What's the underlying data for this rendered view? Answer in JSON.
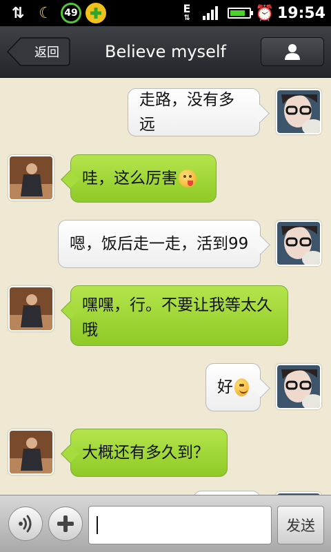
{
  "status_bar": {
    "badge_count": "49",
    "network": "E",
    "time": "19:54",
    "colors": {
      "badge_ring": "#57c53b",
      "battery": "#4bd02c",
      "plus_badge": "#f2c21b"
    },
    "icons": [
      "data-transfer-icon",
      "weather-moon-icon",
      "badge-49-icon",
      "plus-app-icon",
      "network-e-icon",
      "signal-icon",
      "battery-icon",
      "alarm-icon"
    ]
  },
  "header": {
    "back_label": "返回",
    "title": "Believe myself",
    "profile_icon": "person-icon"
  },
  "messages": [
    {
      "side": "right",
      "text": "走路，没有多远"
    },
    {
      "side": "left",
      "text": "哇，这么厉害",
      "emoji": "tongue-wink-emoji"
    },
    {
      "side": "right",
      "text": "嗯，饭后走一走，活到99"
    },
    {
      "side": "left",
      "text": "嘿嘿，行。不要让我等太久哦"
    },
    {
      "side": "right",
      "text": "好",
      "emoji": "smile-emoji"
    },
    {
      "side": "left",
      "text": "大概还有多久到？"
    }
  ],
  "input_bar": {
    "voice_icon": "voice-icon",
    "plus_icon": "plus-icon",
    "input_value": "",
    "send_label": "发送"
  },
  "colors": {
    "chat_background": "#efe9d4",
    "outgoing_bubble": "#ffffff",
    "incoming_bubble": "#9fd43a",
    "header": "#2f3236"
  }
}
